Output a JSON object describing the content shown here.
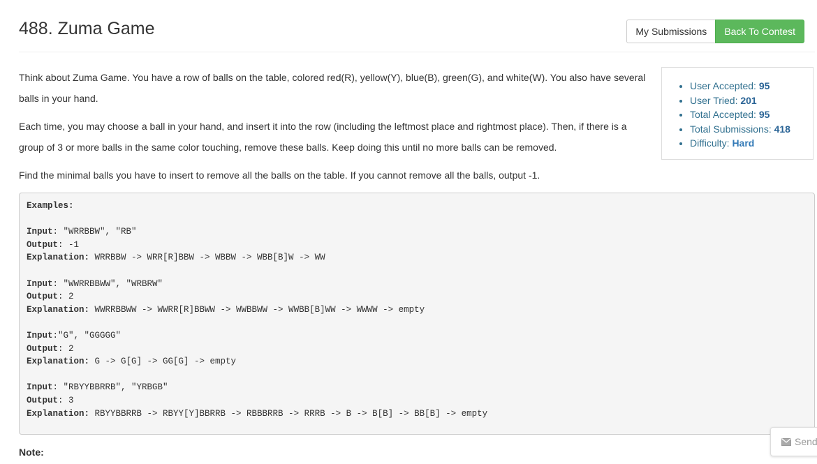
{
  "header": {
    "title": "488. Zuma Game",
    "my_submissions_label": "My Submissions",
    "back_to_contest_label": "Back To Contest"
  },
  "description": {
    "p1": "Think about Zuma Game. You have a row of balls on the table, colored red(R), yellow(Y), blue(B), green(G), and white(W). You also have several balls in your hand.",
    "p2": "Each time, you may choose a ball in your hand, and insert it into the row (including the leftmost place and rightmost place). Then, if there is a group of 3 or more balls in the same color touching, remove these balls. Keep doing this until no more balls can be removed.",
    "p3": "Find the minimal balls you have to insert to remove all the balls on the table. If you cannot remove all the balls, output -1."
  },
  "stats": {
    "user_accepted_label": "User Accepted:",
    "user_accepted": "95",
    "user_tried_label": "User Tried:",
    "user_tried": "201",
    "total_accepted_label": "Total Accepted:",
    "total_accepted": "95",
    "total_submissions_label": "Total Submissions:",
    "total_submissions": "418",
    "difficulty_label": "Difficulty:",
    "difficulty": "Hard"
  },
  "examples": {
    "heading": "Examples:",
    "input_label": "Input",
    "output_label": "Output",
    "explanation_label": "Explanation:",
    "items": [
      {
        "input": ": \"WRRBBW\", \"RB\"",
        "output": ": -1",
        "explanation": " WRRBBW -> WRR[R]BBW -> WBBW -> WBB[B]W -> WW"
      },
      {
        "input": ": \"WWRRBBWW\", \"WRBRW\"",
        "output": ": 2",
        "explanation": " WWRRBBWW -> WWRR[R]BBWW -> WWBBWW -> WWBB[B]WW -> WWWW -> empty"
      },
      {
        "input": ":\"G\", \"GGGGG\"",
        "output": ": 2",
        "explanation": " G -> G[G] -> GG[G] -> empty"
      },
      {
        "input": ": \"RBYYBBRRB\", \"YRBGB\"",
        "output": ": 3",
        "explanation": " RBYYBBRRB -> RBYY[Y]BBRRB -> RBBBRRB -> RRRB -> B -> B[B] -> BB[B] -> empty"
      }
    ]
  },
  "note_label": "Note:",
  "send_label": "Send",
  "colors": {
    "success": "#5cb85c",
    "stat_text": "#31708f",
    "code_bg": "#f5f5f5"
  }
}
